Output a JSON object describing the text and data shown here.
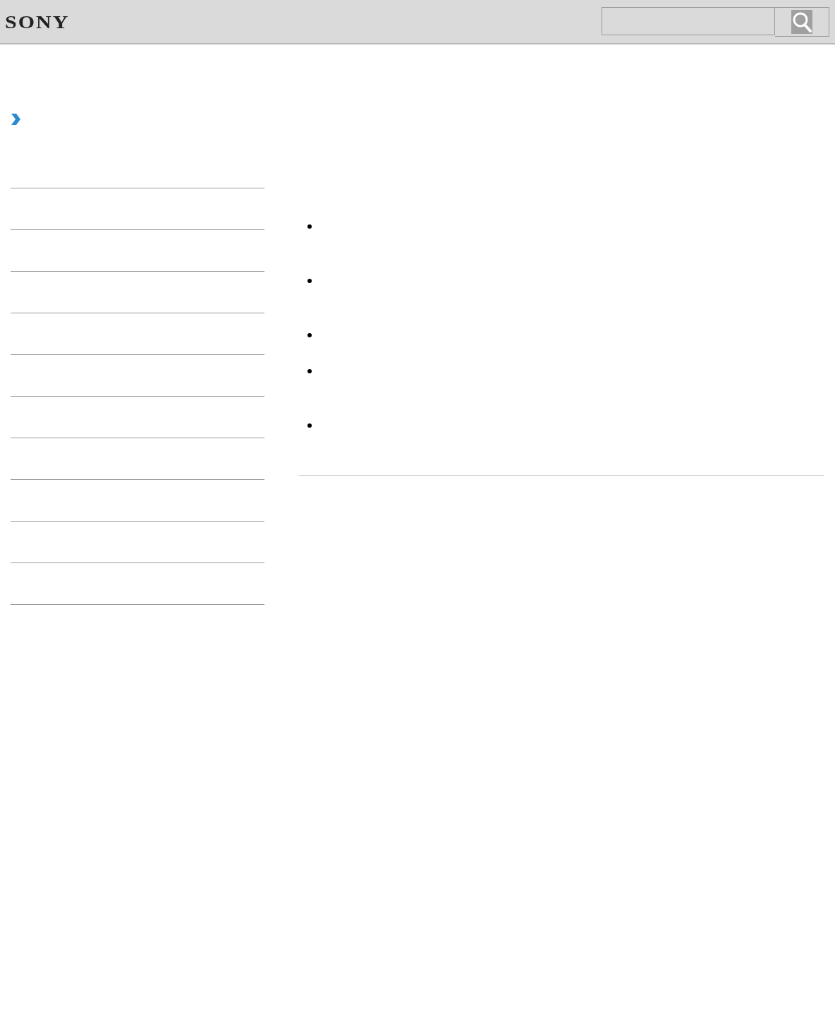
{
  "header": {
    "logo": "SONY",
    "search": {
      "kind": "field"
    }
  },
  "sidebar": {
    "items": [
      {
        "kind": "row"
      },
      {
        "kind": "row"
      },
      {
        "kind": "row"
      },
      {
        "kind": "row"
      },
      {
        "kind": "row"
      },
      {
        "kind": "row"
      },
      {
        "kind": "row"
      },
      {
        "kind": "row"
      },
      {
        "kind": "row"
      },
      {
        "kind": "row"
      }
    ]
  },
  "content": {
    "list_items": [
      {
        "kind": "two-line"
      },
      {
        "kind": "two-line"
      },
      {
        "kind": "one-line"
      },
      {
        "kind": "two-line"
      },
      {
        "kind": "one-line"
      }
    ]
  }
}
